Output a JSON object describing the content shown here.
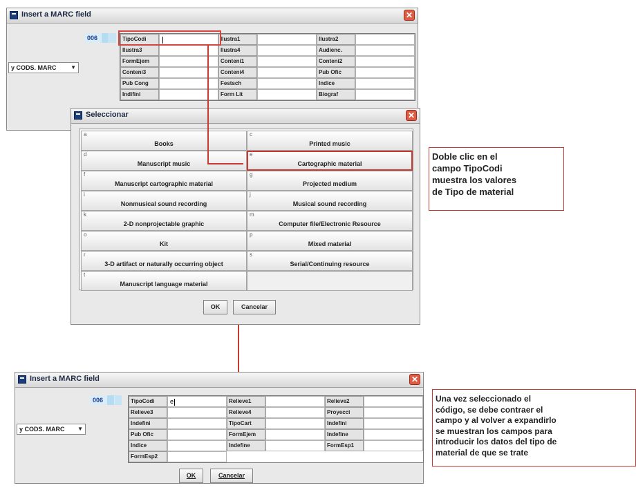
{
  "top_window": {
    "title": "Insert a MARC field",
    "close_glyph": "✕",
    "combo_value": "y CODS. MARC",
    "tag": "006",
    "rows": [
      [
        {
          "label": "TipoCodi",
          "value": ""
        },
        {
          "label": "Ilustra1",
          "value": ""
        },
        {
          "label": "Ilustra2",
          "value": ""
        }
      ],
      [
        {
          "label": "Ilustra3",
          "value": ""
        },
        {
          "label": "Ilustra4",
          "value": ""
        },
        {
          "label": "Audienc.",
          "value": ""
        }
      ],
      [
        {
          "label": "FormEjem",
          "value": ""
        },
        {
          "label": "Conteni1",
          "value": ""
        },
        {
          "label": "Conteni2",
          "value": ""
        }
      ],
      [
        {
          "label": "Conteni3",
          "value": ""
        },
        {
          "label": "Conteni4",
          "value": ""
        },
        {
          "label": "Pub Ofic",
          "value": ""
        }
      ],
      [
        {
          "label": "Pub Cong",
          "value": ""
        },
        {
          "label": "Festsch",
          "value": ""
        },
        {
          "label": "Indice",
          "value": ""
        }
      ],
      [
        {
          "label": "Indifini",
          "value": ""
        },
        {
          "label": "Form Lit",
          "value": ""
        },
        {
          "label": "Biograf",
          "value": ""
        }
      ]
    ]
  },
  "select_dialog": {
    "title": "Seleccionar",
    "close_glyph": "✕",
    "options": [
      {
        "code": "a",
        "name": "Books"
      },
      {
        "code": "c",
        "name": "Printed music"
      },
      {
        "code": "d",
        "name": "Manuscript music"
      },
      {
        "code": "e",
        "name": "Cartographic material"
      },
      {
        "code": "f",
        "name": "Manuscript cartographic material"
      },
      {
        "code": "g",
        "name": "Projected medium"
      },
      {
        "code": "i",
        "name": "Nonmusical sound recording"
      },
      {
        "code": "j",
        "name": "Musical sound recording"
      },
      {
        "code": "k",
        "name": "2-D nonprojectable graphic"
      },
      {
        "code": "m",
        "name": "Computer file/Electronic Resource"
      },
      {
        "code": "o",
        "name": "Kit"
      },
      {
        "code": "p",
        "name": "Mixed material"
      },
      {
        "code": "r",
        "name": "3-D artifact or naturally occurring object"
      },
      {
        "code": "s",
        "name": "Serial/Continuing resource"
      },
      {
        "code": "t",
        "name": "Manuscript language material"
      }
    ],
    "ok_label": "OK",
    "cancel_label": "Cancelar"
  },
  "bottom_window": {
    "title": "Insert a MARC field",
    "close_glyph": "✕",
    "combo_value": "y CODS. MARC",
    "tag": "006",
    "rows": [
      [
        {
          "label": "TipoCodi",
          "value": "e"
        },
        {
          "label": "Relieve1",
          "value": ""
        },
        {
          "label": "Relieve2",
          "value": ""
        }
      ],
      [
        {
          "label": "Relieve3",
          "value": ""
        },
        {
          "label": "Relieve4",
          "value": ""
        },
        {
          "label": "Proyecci",
          "value": ""
        }
      ],
      [
        {
          "label": "Indefini",
          "value": ""
        },
        {
          "label": "TipoCart",
          "value": ""
        },
        {
          "label": "Indefini",
          "value": ""
        }
      ],
      [
        {
          "label": "Pub Ofic",
          "value": ""
        },
        {
          "label": "FormEjem",
          "value": ""
        },
        {
          "label": "Indefine",
          "value": ""
        }
      ],
      [
        {
          "label": "Indice",
          "value": ""
        },
        {
          "label": "Indefine",
          "value": ""
        },
        {
          "label": "FormEsp1",
          "value": ""
        }
      ],
      [
        {
          "label": "FormEsp2",
          "value": ""
        }
      ]
    ],
    "ok_label": "OK",
    "cancel_label": "Cancelar"
  },
  "notes": {
    "top": "Doble clic en el\ncampo TipoCodi\nmuestra los valores\nde Tipo de material",
    "bottom": "Una vez seleccionado el\ncódigo, se debe contraer el\ncampo y al volver a expandirlo\nse muestran los campos para\nintroducir los datos del tipo de\nmaterial de que se trate"
  },
  "colors": {
    "accent_red": "#c63a31",
    "tag_blue": "#1a3c8e",
    "title_icon": "#1b3d7a"
  }
}
